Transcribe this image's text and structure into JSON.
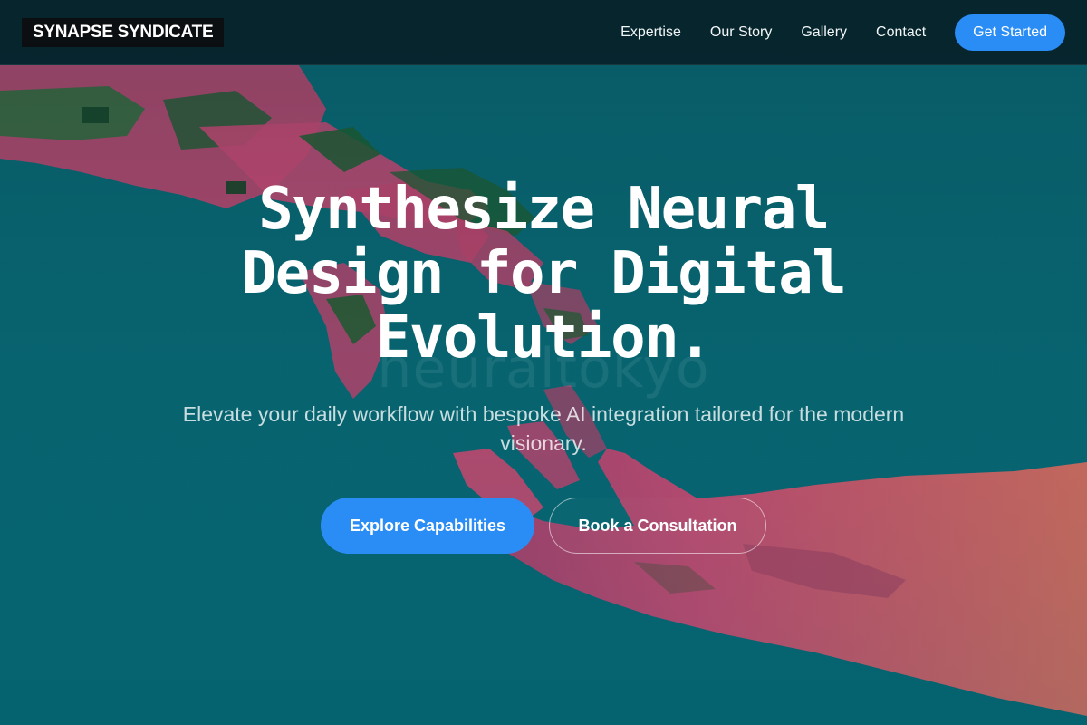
{
  "brand": {
    "logo_text": "SYNAPSE SYNDICATE"
  },
  "nav": {
    "links": [
      "Expertise",
      "Our Story",
      "Gallery",
      "Contact"
    ],
    "cta_label": "Get Started"
  },
  "hero": {
    "title": "Synthesize Neural Design for Digital Evolution.",
    "subtitle": "Elevate your daily workflow with bespoke AI integration tailored for the modern visionary.",
    "primary_cta": "Explore Capabilities",
    "secondary_cta": "Book a Consultation",
    "watermark_text": "neuraltokyo"
  },
  "background": {
    "image": "robot-hand-reaching-human-hand",
    "base_color": "#075a66",
    "hand_color": "#e2456f",
    "robot_joint_color": "#1f5a2a"
  },
  "colors": {
    "accent": "#2a8df5",
    "header_bg": "#0b2128",
    "logo_bg": "#0b0f12",
    "text": "#ffffff"
  }
}
